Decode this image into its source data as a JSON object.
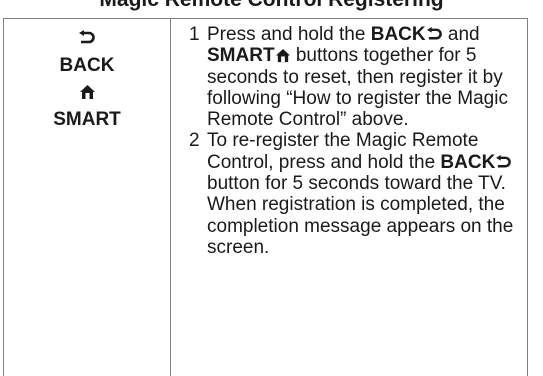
{
  "heading": "Magic Remote Control Registering",
  "keys": {
    "back_label": "BACK",
    "smart_label": "SMART",
    "back_icon": "back-arrow-icon",
    "smart_icon": "home-icon"
  },
  "steps": [
    {
      "number": "1",
      "seg1": "Press and hold the",
      "key_a": "BACK",
      "seg2": "and",
      "key_b": "SMART",
      "seg3": "buttons together for 5 seconds to reset, then register it by following “How to register the Magic Remote Control” above."
    },
    {
      "number": "2",
      "seg1": "To re-register the Magic Remote Control, press and hold the",
      "key_a": "BACK",
      "seg2": "button for 5 seconds toward the TV. When registration is completed, the completion message appears on the screen."
    }
  ]
}
